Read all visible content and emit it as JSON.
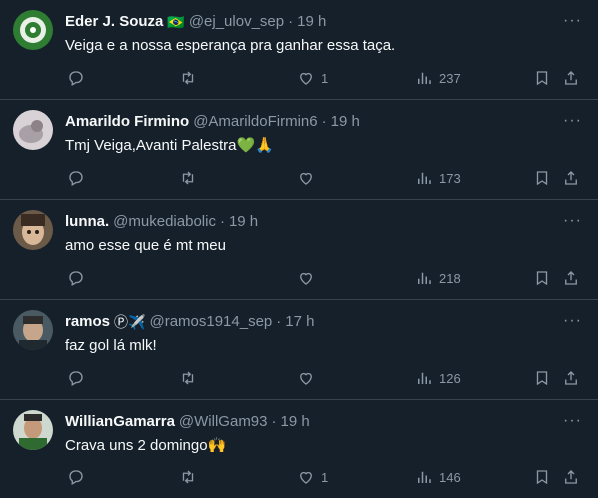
{
  "tweets": [
    {
      "name": "Eder J. Souza",
      "badge": "🇧🇷",
      "handle": "@ej_ulov_sep",
      "time": "19 h",
      "text": "Veiga e a nossa esperança pra ganhar essa taça.",
      "likes": "1",
      "views": "237",
      "avatar_color": "#2e7d32"
    },
    {
      "name": "Amarildo Firmino",
      "badge": "",
      "handle": "@AmarildoFirmin6",
      "time": "19 h",
      "text": "Tmj Veiga,Avanti Palestra💚🙏",
      "likes": "",
      "views": "173",
      "avatar_color": "#c9c2c6"
    },
    {
      "name": "lunna.",
      "badge": "",
      "handle": "@mukediabolic",
      "time": "19 h",
      "text": "amo esse que é mt meu",
      "likes": "",
      "views": "218",
      "avatar_color": "#7a6550"
    },
    {
      "name": "ramos",
      "badge": "Ⓟ✈️",
      "handle": "@ramos1914_sep",
      "time": "17 h",
      "text": "faz gol lá mlk!",
      "likes": "",
      "views": "126",
      "avatar_color": "#5a6b74"
    },
    {
      "name": "WillianGamarra",
      "badge": "",
      "handle": "@WillGam93",
      "time": "19 h",
      "text": "Crava uns 2 domingo🙌",
      "likes": "1",
      "views": "146",
      "avatar_color": "#3d6b3a"
    }
  ],
  "colors": {
    "background": "#15202b",
    "divider": "#38444d",
    "secondary_text": "#8b98a5",
    "primary_text": "#f7f9f9"
  },
  "icons": [
    "reply-icon",
    "retweet-icon",
    "like-icon",
    "views-icon",
    "bookmark-icon",
    "share-icon",
    "more-icon"
  ]
}
